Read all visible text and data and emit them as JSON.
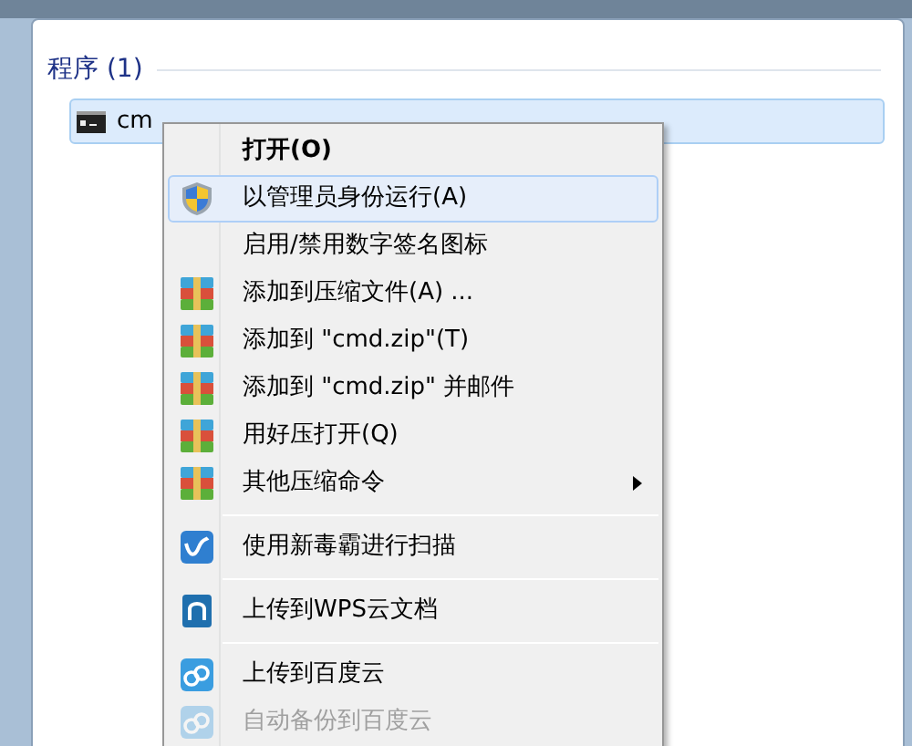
{
  "section": {
    "title": "程序 (1)"
  },
  "results": [
    {
      "label": "cm",
      "selected": true
    }
  ],
  "context_menu": [
    {
      "kind": "item",
      "label": "打开(O)",
      "bold": true,
      "selected": false,
      "disabled": false
    },
    {
      "kind": "item",
      "label": "以管理员身份运行(A)",
      "bold": false,
      "selected": true,
      "disabled": false
    },
    {
      "kind": "item",
      "label": "启用/禁用数字签名图标",
      "bold": false,
      "selected": false,
      "disabled": false
    },
    {
      "kind": "item",
      "label": "添加到压缩文件(A) ...",
      "bold": false,
      "selected": false,
      "disabled": false
    },
    {
      "kind": "item",
      "label": "添加到 \"cmd.zip\"(T)",
      "bold": false,
      "selected": false,
      "disabled": false
    },
    {
      "kind": "item",
      "label": "添加到 \"cmd.zip\" 并邮件",
      "bold": false,
      "selected": false,
      "disabled": false
    },
    {
      "kind": "item",
      "label": "用好压打开(Q)",
      "bold": false,
      "selected": false,
      "disabled": false
    },
    {
      "kind": "submenu",
      "label": "其他压缩命令",
      "bold": false,
      "selected": false,
      "disabled": false
    },
    {
      "kind": "separator"
    },
    {
      "kind": "item",
      "label": "使用新毒霸进行扫描",
      "bold": false,
      "selected": false,
      "disabled": false
    },
    {
      "kind": "separator"
    },
    {
      "kind": "item",
      "label": "上传到WPS云文档",
      "bold": false,
      "selected": false,
      "disabled": false
    },
    {
      "kind": "separator"
    },
    {
      "kind": "item",
      "label": "上传到百度云",
      "bold": false,
      "selected": false,
      "disabled": false
    },
    {
      "kind": "item",
      "label": "自动备份到百度云",
      "bold": false,
      "selected": false,
      "disabled": true
    }
  ]
}
